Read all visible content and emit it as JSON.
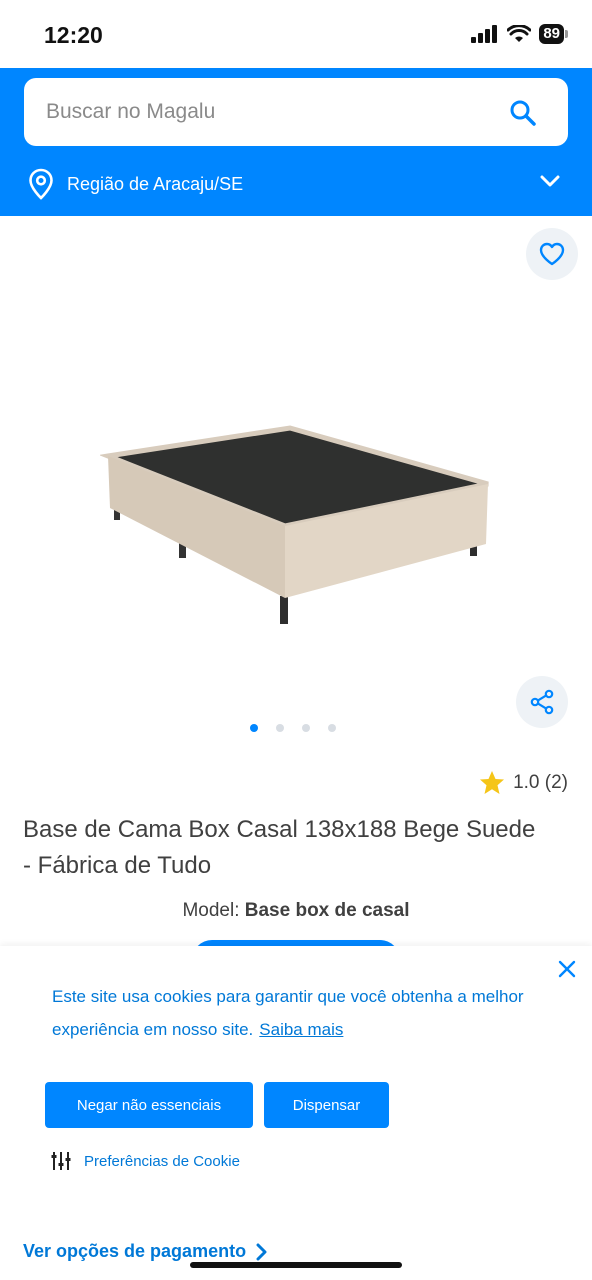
{
  "status_bar": {
    "time": "12:20",
    "battery": "89",
    "icons": [
      "signal-icon",
      "wifi-icon",
      "battery-icon"
    ]
  },
  "header": {
    "search_placeholder": "Buscar no Magalu",
    "location": "Região de Aracaju/SE",
    "brand_color": "#0086ff"
  },
  "product": {
    "image_dots_total": 4,
    "image_dot_active": 1,
    "rating": "1.0 (2)",
    "title": "Base de Cama Box Casal 138x188 Bege Suede - Fábrica de Tudo",
    "model_label": "Model:",
    "model_value": "Base box de casal"
  },
  "cookie_banner": {
    "text": "Este site usa cookies para garantir que você obtenha a melhor experiência em nosso site.",
    "link": "Saiba mais",
    "deny_button": "Negar não essenciais",
    "dismiss_button": "Dispensar",
    "preferences": "Preferências de Cookie"
  },
  "bottom": {
    "payment_link": "Ver opções de pagamento"
  }
}
